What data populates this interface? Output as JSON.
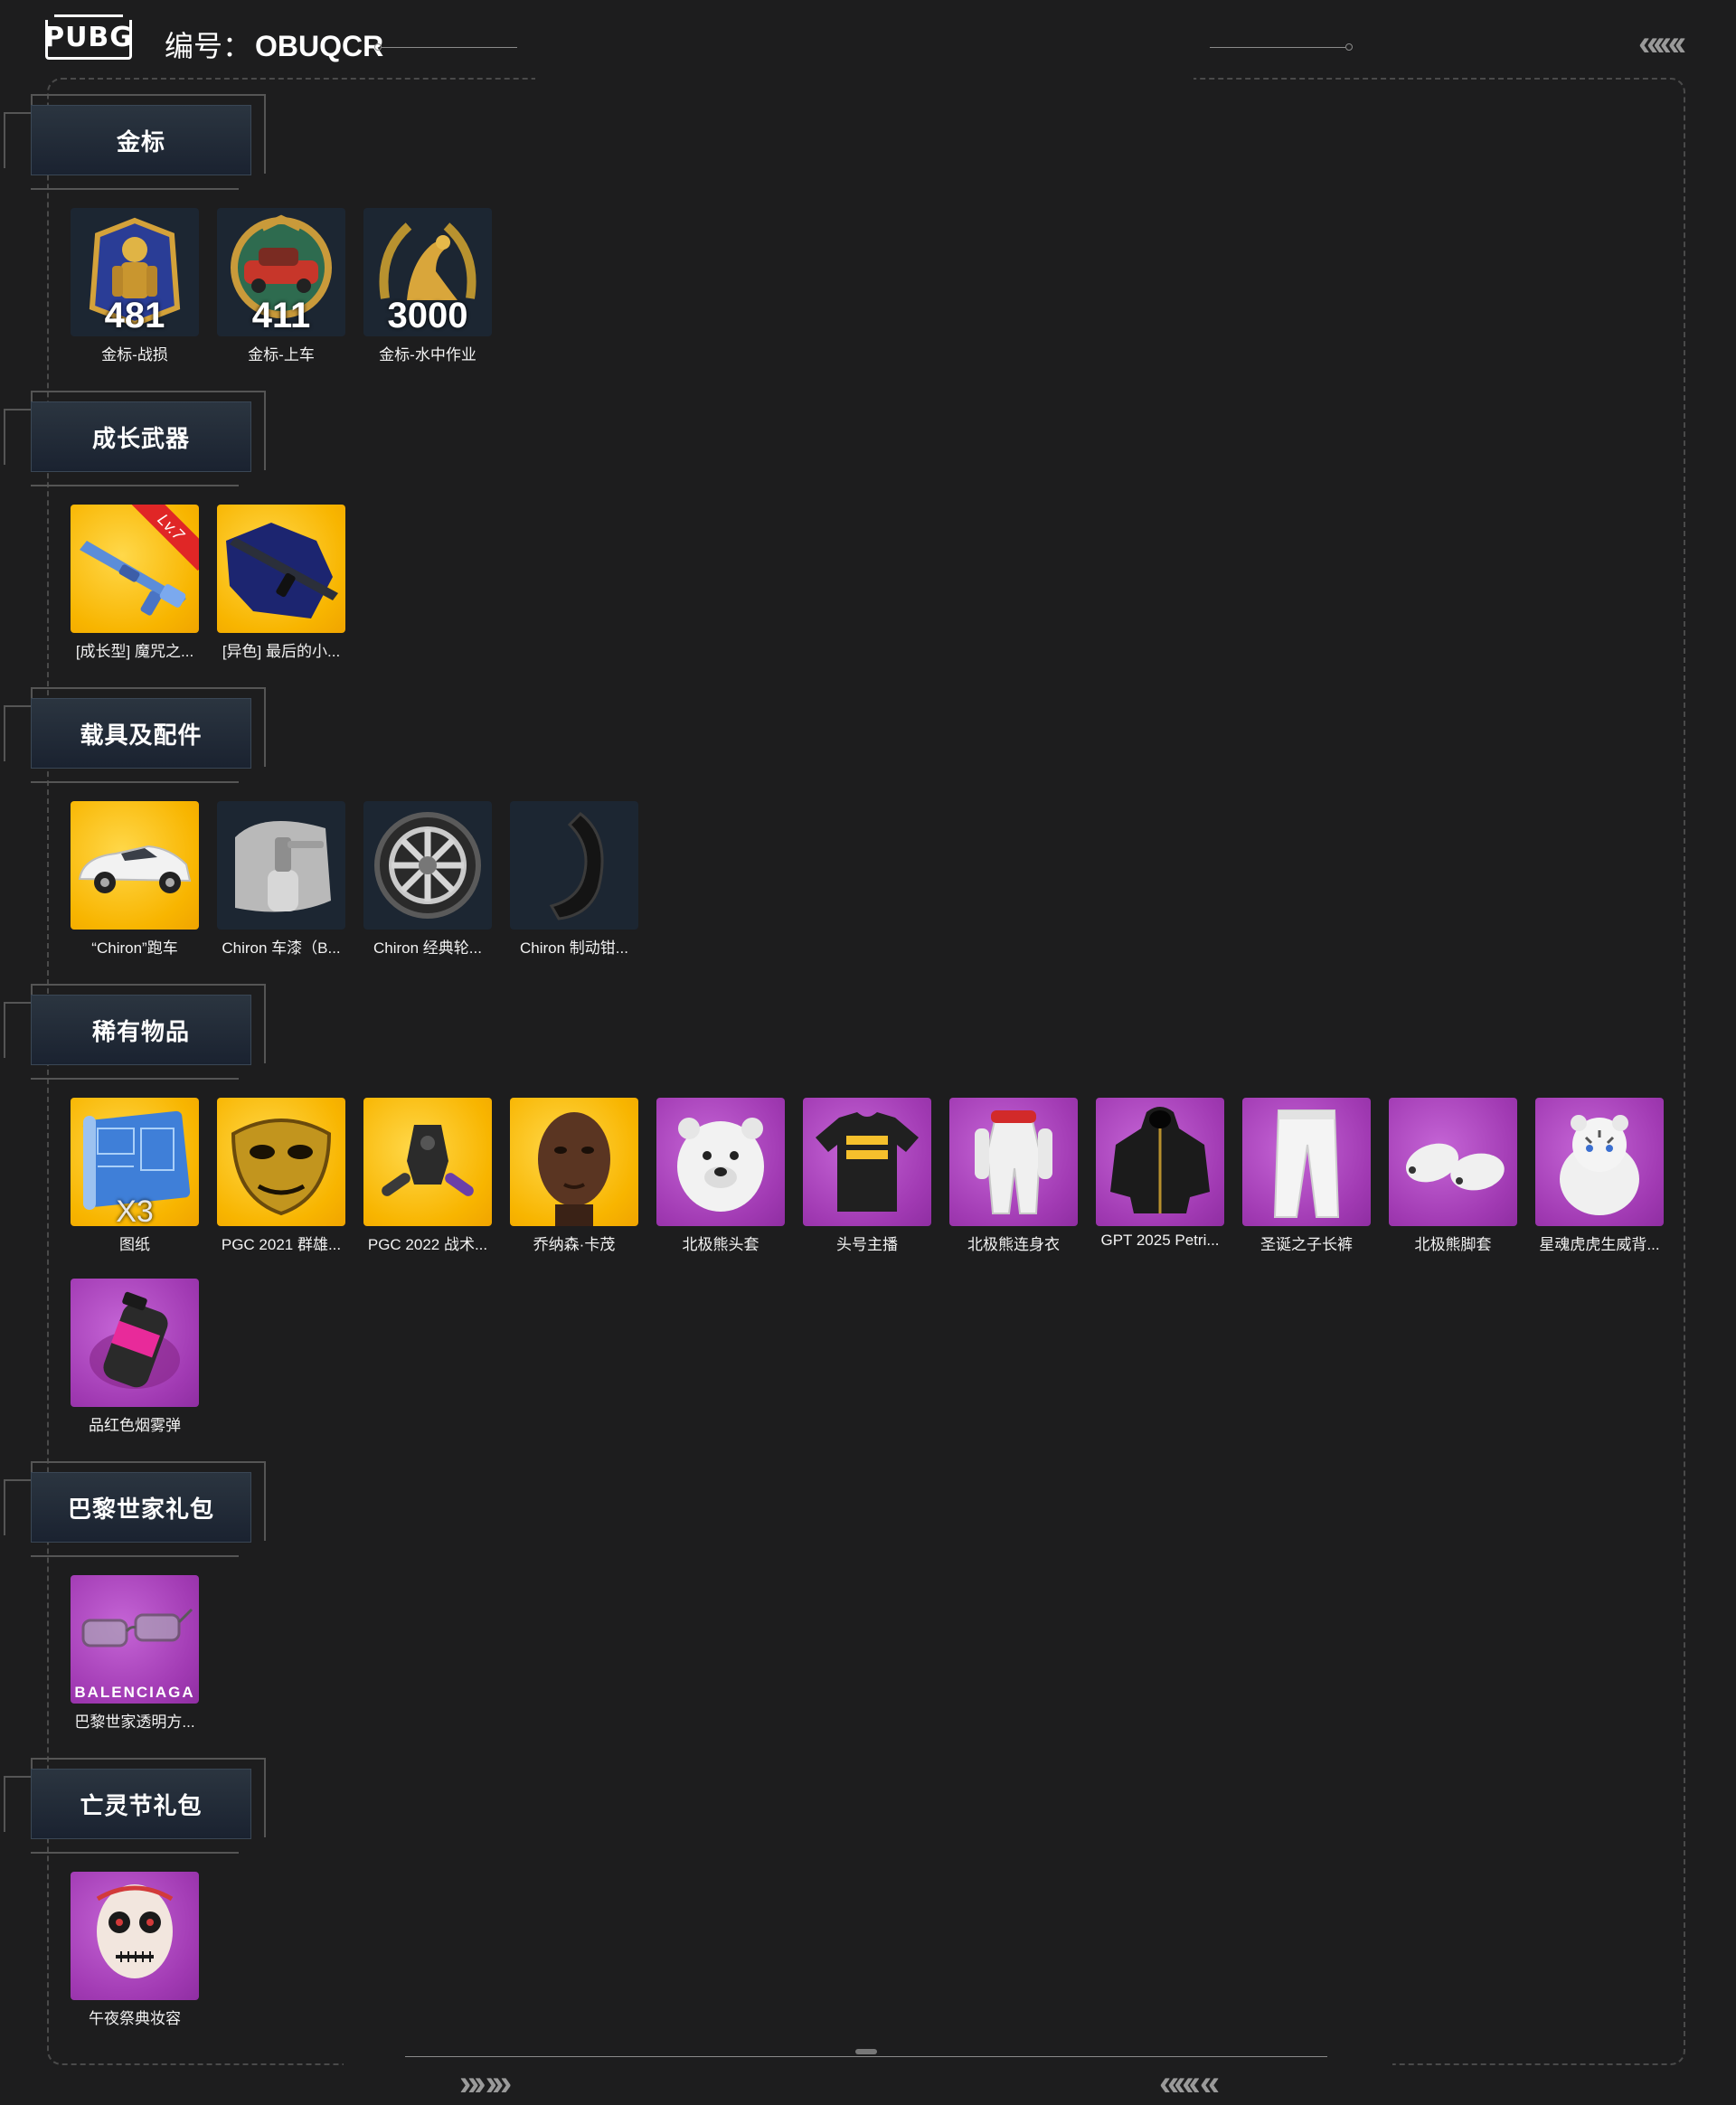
{
  "header": {
    "logo_text": "PUBG",
    "code_label": "编号：",
    "code_value": "OBUQCR",
    "corner_chevrons": "«‹«‹",
    "footer_left_chevrons": "»› ›»",
    "footer_right_chevrons": "««‹ «"
  },
  "colors": {
    "background": "#1d1d1e",
    "gold_tier": "#f8b500",
    "purple_tier": "#a13ab3",
    "dark_tier": "#1c2632",
    "section_head": "#1a2230"
  },
  "sections": [
    {
      "title": "金标",
      "items": [
        {
          "name": "金标-战损",
          "count": "481",
          "tier": "dark",
          "icon": "gold-badge-soldier-icon"
        },
        {
          "name": "金标-上车",
          "count": "411",
          "tier": "dark",
          "icon": "gold-badge-car-icon"
        },
        {
          "name": "金标-水中作业",
          "count": "3000",
          "tier": "dark",
          "icon": "gold-badge-seal-icon"
        }
      ]
    },
    {
      "title": "成长武器",
      "items": [
        {
          "name": "[成长型] 魔咒之...",
          "tier": "gold",
          "level": "Lv.7",
          "icon": "rifle-icon"
        },
        {
          "name": "[异色] 最后的小...",
          "tier": "gold",
          "icon": "dark-rifle-icon"
        }
      ]
    },
    {
      "title": "载具及配件",
      "items": [
        {
          "name": "“Chiron”跑车",
          "tier": "gold",
          "icon": "sports-car-icon"
        },
        {
          "name": "Chiron 车漆（B...",
          "tier": "dark",
          "icon": "paint-spray-icon"
        },
        {
          "name": "Chiron 经典轮...",
          "tier": "dark",
          "icon": "wheel-icon"
        },
        {
          "name": "Chiron 制动钳...",
          "tier": "dark",
          "icon": "brake-caliper-icon"
        }
      ]
    },
    {
      "title": "稀有物品",
      "items": [
        {
          "name": "图纸",
          "tier": "gold",
          "count_x": "X3",
          "icon": "blueprint-icon"
        },
        {
          "name": "PGC 2021 群雄...",
          "tier": "gold",
          "icon": "gold-mask-icon"
        },
        {
          "name": "PGC 2022 战术...",
          "tier": "gold",
          "icon": "tactical-gear-icon"
        },
        {
          "name": "乔纳森·卡茂",
          "tier": "gold",
          "icon": "character-face-icon"
        },
        {
          "name": "北极熊头套",
          "tier": "purple",
          "icon": "polar-bear-head-icon"
        },
        {
          "name": "头号主播",
          "tier": "purple",
          "icon": "tshirt-icon"
        },
        {
          "name": "北极熊连身衣",
          "tier": "purple",
          "icon": "jumpsuit-icon"
        },
        {
          "name": "GPT 2025 Petri...",
          "tier": "purple",
          "icon": "hooded-jacket-icon"
        },
        {
          "name": "圣诞之子长裤",
          "tier": "purple",
          "icon": "pants-icon"
        },
        {
          "name": "北极熊脚套",
          "tier": "purple",
          "icon": "bear-feet-icon"
        },
        {
          "name": "星魂虎虎生威背...",
          "tier": "purple",
          "icon": "tiger-backpack-icon"
        },
        {
          "name": "品红色烟雾弹",
          "tier": "purple",
          "icon": "smoke-grenade-icon"
        }
      ]
    },
    {
      "title": "巴黎世家礼包",
      "items": [
        {
          "name": "巴黎世家透明方...",
          "tier": "purple",
          "brand": "BALENCIAGA",
          "icon": "sunglasses-icon"
        }
      ]
    },
    {
      "title": "亡灵节礼包",
      "items": [
        {
          "name": "午夜祭典妆容",
          "tier": "purple",
          "icon": "skull-makeup-face-icon"
        }
      ]
    }
  ]
}
